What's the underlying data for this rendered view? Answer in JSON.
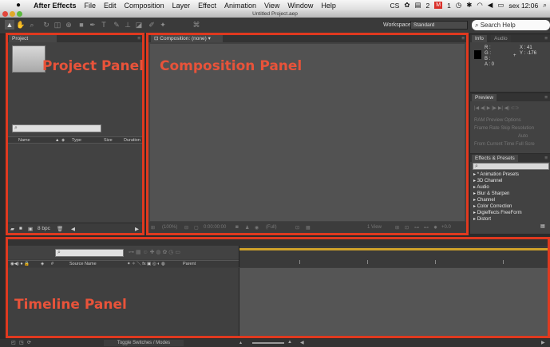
{
  "menubar": {
    "app": "After Effects",
    "items": [
      "File",
      "Edit",
      "Composition",
      "Layer",
      "Effect",
      "Animation",
      "View",
      "Window",
      "Help"
    ],
    "right": {
      "cs": "CS",
      "badge1": "2",
      "badge2": "1",
      "clock": "sex 12:06"
    }
  },
  "window": {
    "title": "Untitled Project.aep"
  },
  "toolbar": {
    "workspace_label": "Workspace:",
    "workspace_value": "Standard",
    "search_help": "Search Help"
  },
  "project": {
    "tab": "Project",
    "columns": [
      "Name",
      "Type",
      "Size",
      "Duration"
    ],
    "bpc": "8 bpc",
    "search_glyph": "⌕"
  },
  "composition": {
    "tab": "Composition: (none)",
    "zoom": "(100%)",
    "time": "0:00:00:00",
    "resolution": "(Full)",
    "view": "1 View",
    "exposure": "+0.0"
  },
  "info": {
    "tab": "Info",
    "tab2": "Audio",
    "r": "R :",
    "g": "G :",
    "b": "B :",
    "a": "A : 0",
    "x": "X : 41",
    "y": "Y : -176"
  },
  "preview": {
    "tab": "Preview",
    "ram": "RAM Preview Options",
    "frame_rate": "Frame Rate",
    "skip": "Skip",
    "resolution": "Resolution",
    "auto": "Auto",
    "from_current": "From Current Time",
    "full_screen": "Full Scre"
  },
  "effects": {
    "tab": "Effects & Presets",
    "items": [
      "* Animation Presets",
      "3D Channel",
      "Audio",
      "Blur & Sharpen",
      "Channel",
      "Color Correction",
      "Digieffects FreeForm",
      "Distort"
    ]
  },
  "timeline": {
    "columns": {
      "source": "Source Name",
      "parent": "Parent"
    },
    "toggle": "Toggle Switches / Modes"
  },
  "annotations": {
    "project": "Project Panel",
    "composition": "Composition Panel",
    "timeline": "Timeline Panel",
    "color": "#e0391f"
  }
}
